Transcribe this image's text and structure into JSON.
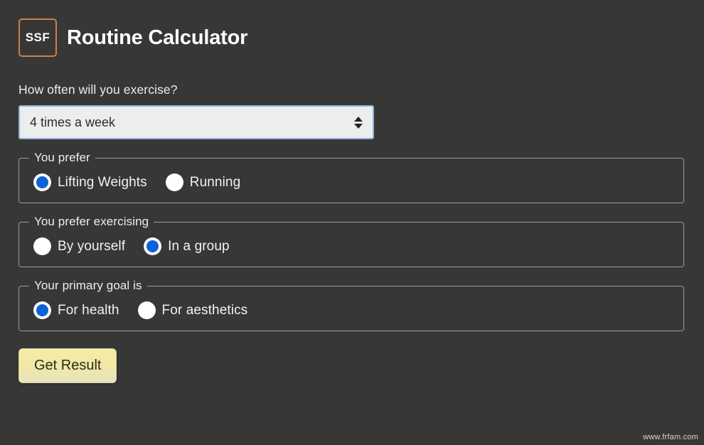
{
  "header": {
    "logo_text": "SSF",
    "title": "Routine Calculator"
  },
  "form": {
    "frequency": {
      "label": "How often will you exercise?",
      "selected_value": "4 times a week"
    },
    "fieldsets": [
      {
        "legend": "You prefer",
        "options": [
          {
            "label": "Lifting Weights",
            "checked": true
          },
          {
            "label": "Running",
            "checked": false
          }
        ]
      },
      {
        "legend": "You prefer exercising",
        "options": [
          {
            "label": "By yourself",
            "checked": false
          },
          {
            "label": "In a group",
            "checked": true
          }
        ]
      },
      {
        "legend": "Your primary goal is",
        "options": [
          {
            "label": "For health",
            "checked": true
          },
          {
            "label": "For aesthetics",
            "checked": false
          }
        ]
      }
    ],
    "submit_label": "Get Result"
  },
  "watermark": "www.frfam.com",
  "colors": {
    "page_background": "#373735",
    "logo_border": "#c8834c",
    "radio_accent": "#0a63d8",
    "select_border": "#8cb4d8",
    "select_background": "#eceeee",
    "button_background": "#f4ea9f",
    "fieldset_border": "#9b9b99"
  }
}
